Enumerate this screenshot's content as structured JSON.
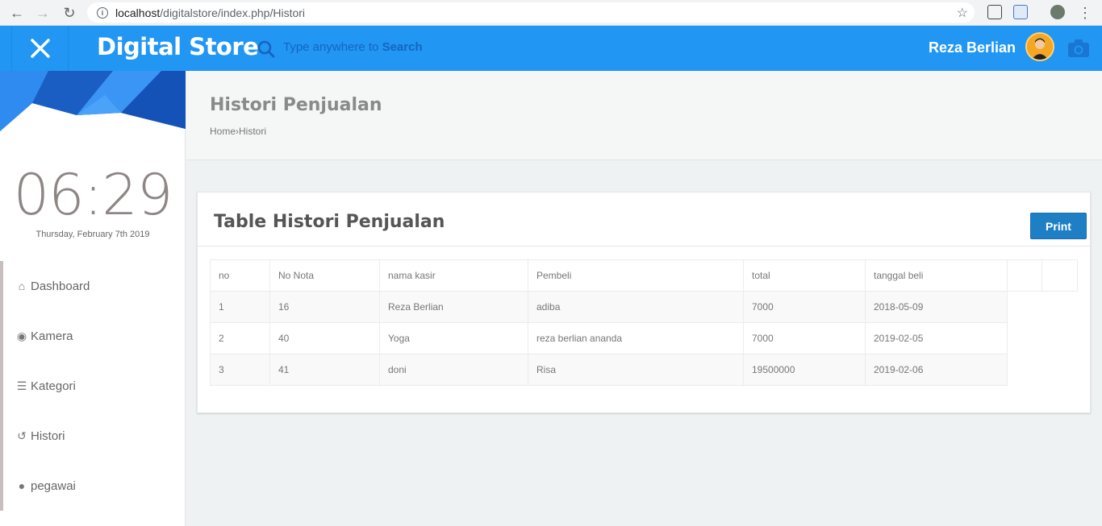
{
  "browser": {
    "url_host": "localhost",
    "url_path": "/digitalstore/index.php/Histori"
  },
  "topbar": {
    "brand": "Digital Store",
    "search_prefix": "Type anywhere to",
    "search_bold": "Search",
    "user_name": "Reza Berlian"
  },
  "sidebar": {
    "clock": "06:29",
    "date": "Thursday, February 7th 2019",
    "items": [
      {
        "label": "Dashboard",
        "icon": "home-icon",
        "glyph": "⌂"
      },
      {
        "label": "Kamera",
        "icon": "camera-icon",
        "glyph": "◉"
      },
      {
        "label": "Kategori",
        "icon": "list-icon",
        "glyph": "☰"
      },
      {
        "label": "Histori",
        "icon": "history-icon",
        "glyph": "↺"
      },
      {
        "label": "pegawai",
        "icon": "user-icon",
        "glyph": "●"
      }
    ]
  },
  "page": {
    "title": "Histori Penjualan",
    "breadcrumb_home": "Home",
    "breadcrumb_sep": "›",
    "breadcrumb_current": "Histori"
  },
  "card": {
    "title": "Table Histori Penjualan",
    "print_label": "Print"
  },
  "table": {
    "headers": [
      "no",
      "No Nota",
      "nama kasir",
      "Pembeli",
      "total",
      "tanggal beli"
    ],
    "rows": [
      [
        "1",
        "16",
        "Reza Berlian",
        "adiba",
        "7000",
        "2018-05-09"
      ],
      [
        "2",
        "40",
        "Yoga",
        "reza berlian ananda",
        "7000",
        "2019-02-05"
      ],
      [
        "3",
        "41",
        "doni",
        "Risa",
        "19500000",
        "2019-02-06"
      ]
    ]
  },
  "colors": {
    "header_blue": "#2196f3",
    "print_button": "#1e7fc4"
  }
}
